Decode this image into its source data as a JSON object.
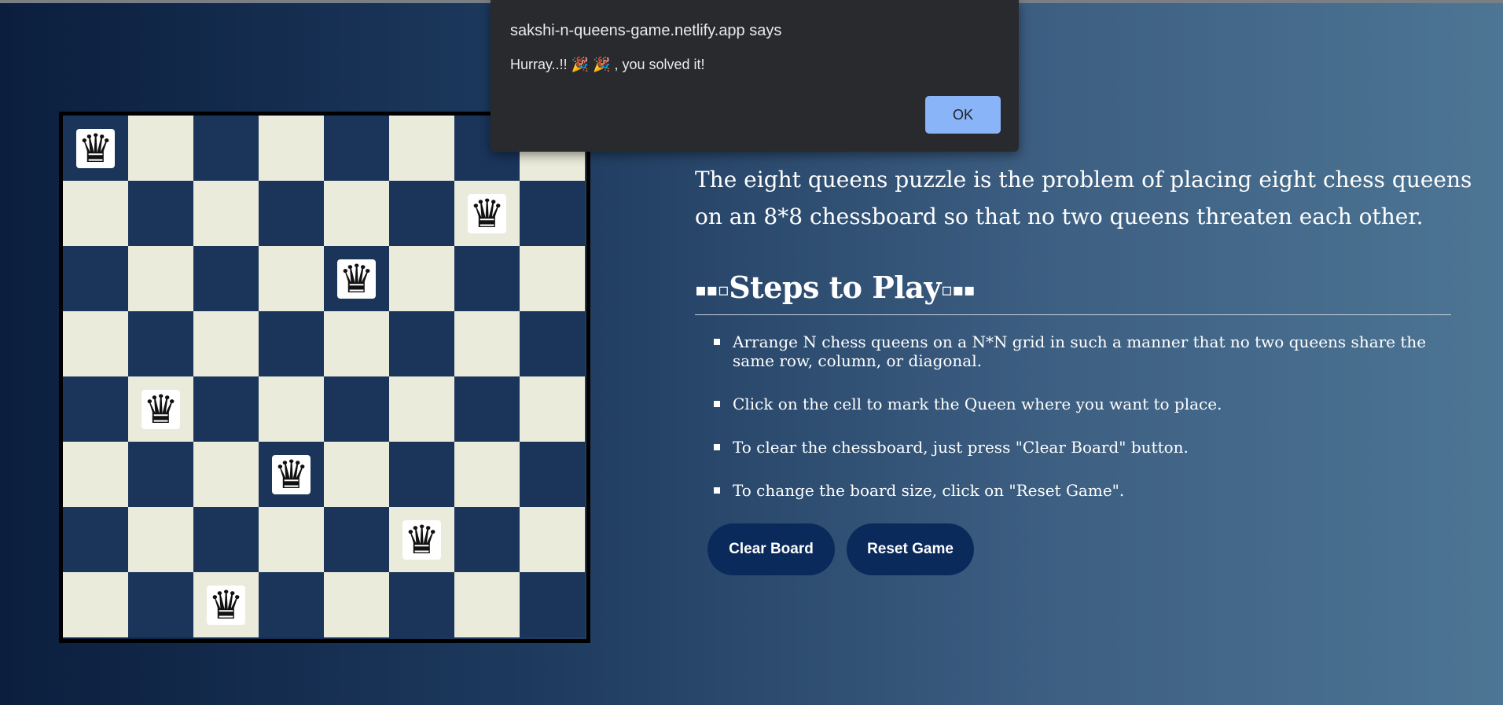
{
  "board": {
    "size": 8,
    "queen_symbol": "♛",
    "queens": [
      {
        "row": 0,
        "col": 0
      },
      {
        "row": 1,
        "col": 6
      },
      {
        "row": 2,
        "col": 4
      },
      {
        "row": 4,
        "col": 1
      },
      {
        "row": 5,
        "col": 3
      },
      {
        "row": 6,
        "col": 5
      },
      {
        "row": 7,
        "col": 2
      }
    ],
    "colors": {
      "light": "#ebebdc",
      "dark": "#1a345a"
    }
  },
  "intro": {
    "text": "The eight queens puzzle is the problem of placing eight chess queens on an 8*8 chessboard so that no two queens threaten each other."
  },
  "steps": {
    "heading_prefix": "▪▪▫",
    "heading": "Steps to Play",
    "heading_suffix": "▫▪▪",
    "items": [
      "Arrange N chess queens on a N*N grid in such a manner that no two queens share the same row, column, or diagonal.",
      "Click on the cell to mark the Queen where you want to place.",
      "To clear the chessboard, just press \"Clear Board\" button.",
      "To change the board size, click on \"Reset Game\"."
    ]
  },
  "buttons": {
    "clear_board": "Clear Board",
    "reset_game": "Reset Game"
  },
  "dialog": {
    "title": "sakshi-n-queens-game.netlify.app says",
    "message": "Hurray..!! 🎉 🎉 , you solved it!",
    "ok_label": "OK"
  }
}
